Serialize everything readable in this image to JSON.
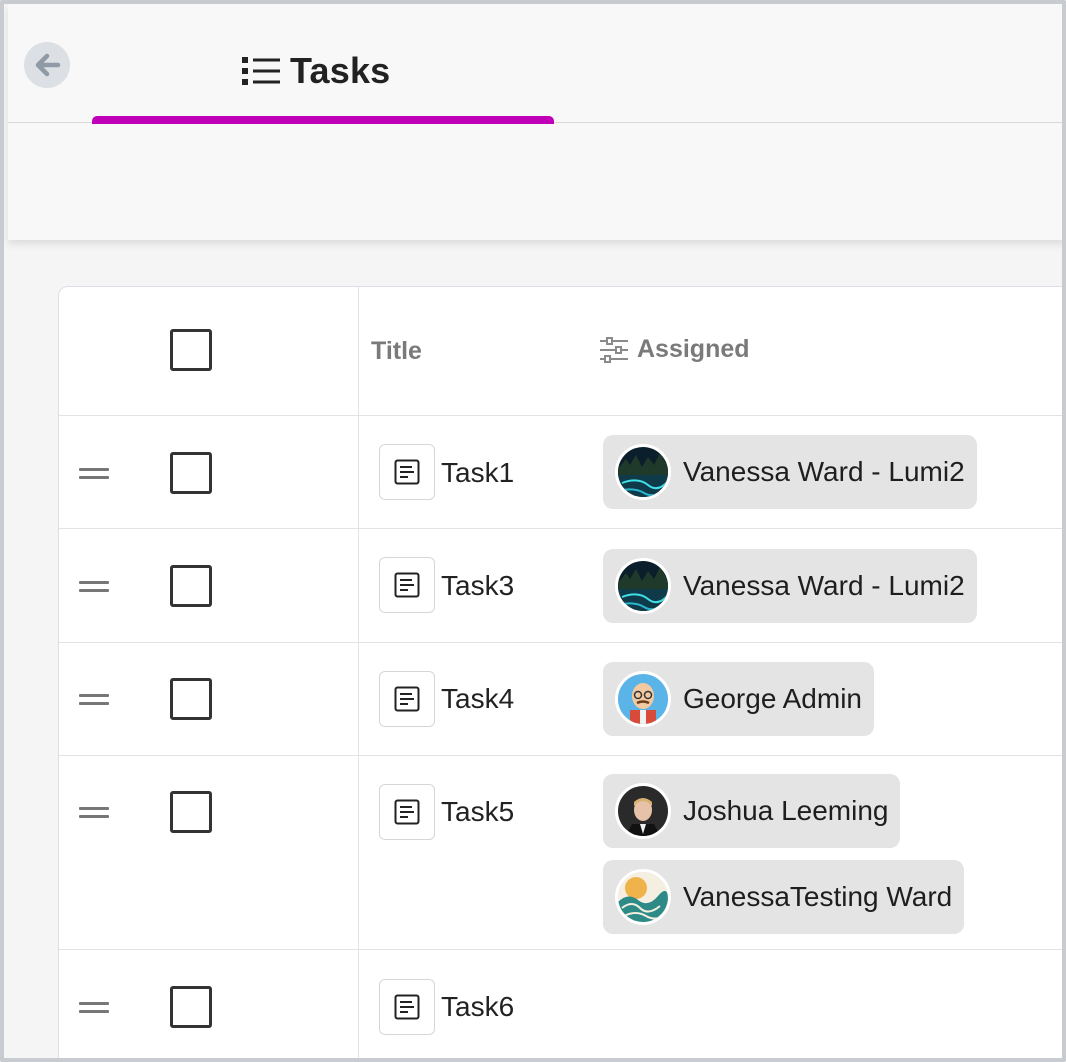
{
  "header": {
    "back_icon": "arrow-left-icon",
    "tab_icon": "list-icon",
    "tab_label": "Tasks",
    "accent_color": "#c000b8"
  },
  "table": {
    "columns": {
      "title": "Title",
      "assigned": "Assigned",
      "assigned_icon": "sliders-icon"
    },
    "rows": [
      {
        "title": "Task1",
        "assignees": [
          {
            "name": "Vanessa Ward - Lumi2",
            "avatar": "night-lake-avatar"
          }
        ]
      },
      {
        "title": "Task3",
        "assignees": [
          {
            "name": "Vanessa Ward - Lumi2",
            "avatar": "night-lake-avatar"
          }
        ]
      },
      {
        "title": "Task4",
        "assignees": [
          {
            "name": "George Admin",
            "avatar": "cartoon-man-avatar"
          }
        ]
      },
      {
        "title": "Task5",
        "assignees": [
          {
            "name": "Joshua Leeming",
            "avatar": "portrait-avatar"
          },
          {
            "name": "VanessaTesting Ward",
            "avatar": "wave-art-avatar"
          }
        ]
      },
      {
        "title": "Task6",
        "assignees": []
      }
    ]
  }
}
